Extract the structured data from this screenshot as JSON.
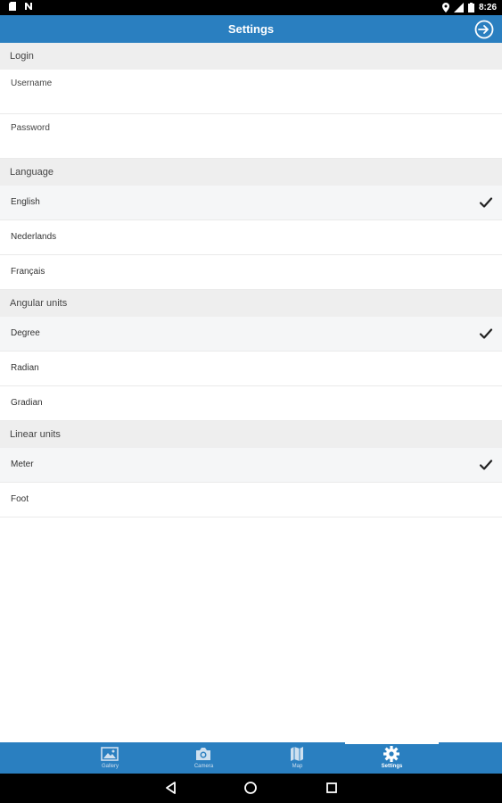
{
  "status_bar": {
    "time": "8:26",
    "icons_left": [
      "sd-card-icon",
      "n-notification-icon"
    ],
    "icons_right": [
      "location-icon",
      "signal-icon",
      "battery-icon"
    ]
  },
  "app_bar": {
    "title": "Settings",
    "action_icon": "login-icon"
  },
  "sections": {
    "login": {
      "header": "Login",
      "username_label": "Username",
      "username_value": "",
      "password_label": "Password",
      "password_value": ""
    },
    "language": {
      "header": "Language",
      "options": [
        {
          "label": "English",
          "selected": true
        },
        {
          "label": "Nederlands",
          "selected": false
        },
        {
          "label": "Français",
          "selected": false
        }
      ]
    },
    "angular_units": {
      "header": "Angular units",
      "options": [
        {
          "label": "Degree",
          "selected": true
        },
        {
          "label": "Radian",
          "selected": false
        },
        {
          "label": "Gradian",
          "selected": false
        }
      ]
    },
    "linear_units": {
      "header": "Linear units",
      "options": [
        {
          "label": "Meter",
          "selected": true
        },
        {
          "label": "Foot",
          "selected": false
        }
      ]
    }
  },
  "bottom_nav": {
    "items": [
      {
        "label": "Gallery",
        "icon": "gallery-icon",
        "active": false
      },
      {
        "label": "Camera",
        "icon": "camera-icon",
        "active": false
      },
      {
        "label": "Map",
        "icon": "map-icon",
        "active": false
      },
      {
        "label": "Settings",
        "icon": "gear-icon",
        "active": true
      }
    ]
  },
  "system_nav": {
    "buttons": [
      "back-icon",
      "home-icon",
      "recents-icon"
    ]
  },
  "colors": {
    "primary": "#2a7fc0",
    "section_bg": "#eeeeee",
    "selected_row_bg": "#f5f6f7"
  }
}
